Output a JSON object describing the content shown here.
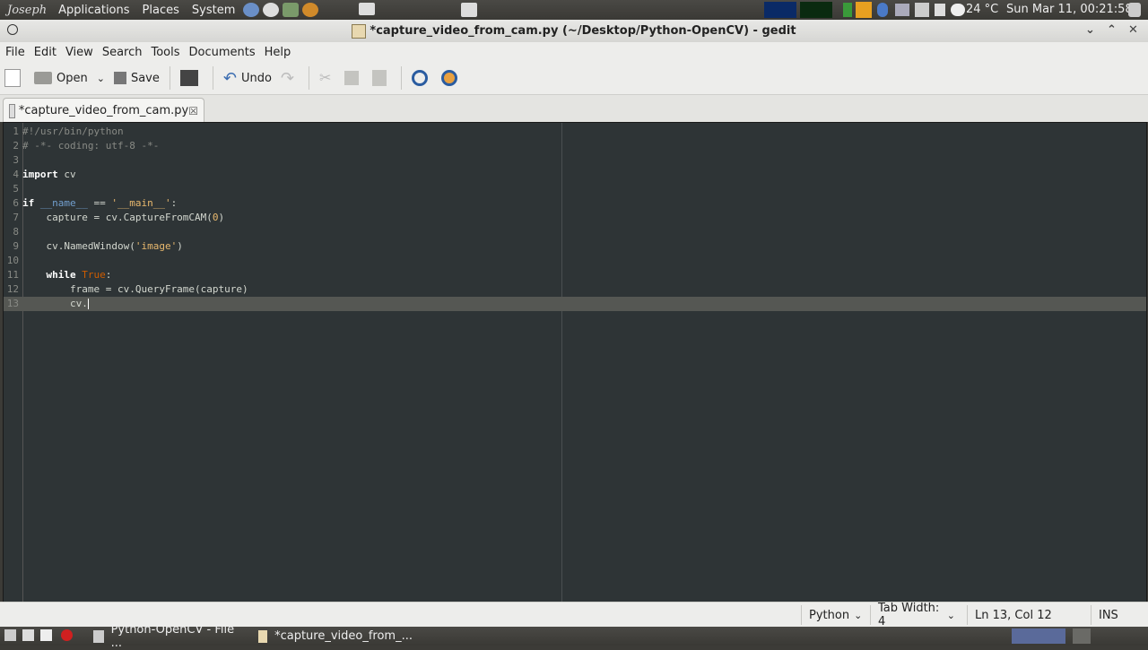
{
  "top_panel": {
    "user": "Joseph",
    "menus": [
      "Applications",
      "Places",
      "System"
    ],
    "temperature": "24 °C",
    "datetime": "Sun Mar 11, 00:21:58"
  },
  "window": {
    "title": "*capture_video_from_cam.py (~/Desktop/Python-OpenCV) - gedit"
  },
  "menubar": [
    "File",
    "Edit",
    "View",
    "Search",
    "Tools",
    "Documents",
    "Help"
  ],
  "toolbar": {
    "open_label": "Open",
    "save_label": "Save",
    "undo_label": "Undo"
  },
  "tab": {
    "label": "*capture_video_from_cam.py"
  },
  "editor": {
    "lines": [
      "#!/usr/bin/python",
      "# -*- coding: utf-8 -*-",
      "",
      "import cv",
      "",
      "if __name__ == '__main__':",
      "    capture = cv.CaptureFromCAM(0)",
      "",
      "    cv.NamedWindow('image')",
      "",
      "    while True:",
      "        frame = cv.QueryFrame(capture)",
      "        cv."
    ],
    "current_line": 13
  },
  "statusbar": {
    "language": "Python",
    "tab_width": "Tab Width: 4",
    "position": "Ln 13, Col 12",
    "mode": "INS"
  },
  "taskbar": {
    "items": [
      "Python-OpenCV - File ...",
      "*capture_video_from_..."
    ]
  },
  "colors": {
    "editor_bg": "#2e3436",
    "current_line": "#555753",
    "panel": "#3c3b37"
  }
}
